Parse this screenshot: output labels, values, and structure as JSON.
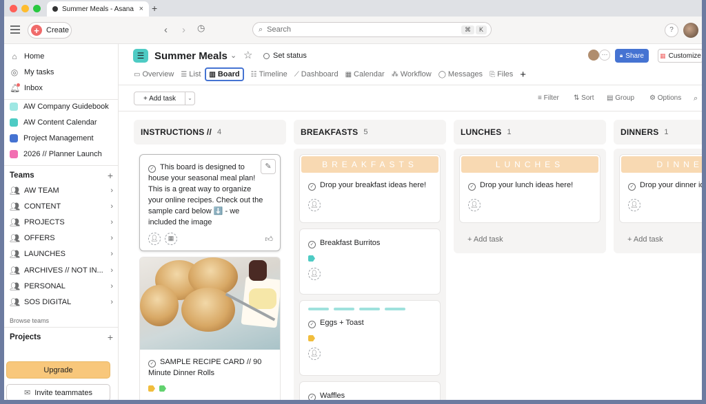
{
  "browser": {
    "tab_title": "Summer Meals - Asana",
    "close": "×",
    "new_tab": "+"
  },
  "topbar": {
    "create_label": "Create",
    "search_placeholder": "Search",
    "kbd": [
      "⌘",
      "K"
    ],
    "help": "?"
  },
  "sidebar": {
    "nav": [
      {
        "label": "Home",
        "icon": "home-icon"
      },
      {
        "label": "My tasks",
        "icon": "check-circle-icon"
      },
      {
        "label": "Inbox",
        "icon": "bell-icon"
      }
    ],
    "projects_pinned": [
      {
        "label": "AW Company Guidebook",
        "color": "#9ee7e3"
      },
      {
        "label": "AW Content Calendar",
        "color": "#4ecbc4"
      },
      {
        "label": "Project Management",
        "color": "#4573d2"
      },
      {
        "label": "2026 // Planner Launch",
        "color": "#f26fb2"
      }
    ],
    "teams_header": "Teams",
    "teams": [
      "AW TEAM",
      "CONTENT",
      "PROJECTS",
      "OFFERS",
      "LAUNCHES",
      "ARCHIVES // NOT IN...",
      "PERSONAL",
      "SOS DIGITAL"
    ],
    "browse_teams": "Browse teams",
    "projects_header": "Projects",
    "upgrade": "Upgrade",
    "invite": "Invite teammates"
  },
  "project": {
    "title": "Summer Meals",
    "set_status": "Set status",
    "share": "Share",
    "customize": "Customize",
    "tabs": [
      {
        "label": "Overview",
        "icon": "overview-icon"
      },
      {
        "label": "List",
        "icon": "list-icon"
      },
      {
        "label": "Board",
        "icon": "board-icon",
        "active": true
      },
      {
        "label": "Timeline",
        "icon": "timeline-icon"
      },
      {
        "label": "Dashboard",
        "icon": "dashboard-icon"
      },
      {
        "label": "Calendar",
        "icon": "calendar-icon"
      },
      {
        "label": "Workflow",
        "icon": "workflow-icon"
      },
      {
        "label": "Messages",
        "icon": "messages-icon"
      },
      {
        "label": "Files",
        "icon": "files-icon"
      }
    ],
    "add_tab": "+"
  },
  "toolbar": {
    "add_task": "+ Add task",
    "filter": "Filter",
    "sort": "Sort",
    "group": "Group",
    "options": "Options"
  },
  "columns": [
    {
      "name": "INSTRUCTIONS //",
      "count": "4",
      "cards": [
        {
          "title": "This board is designed to house your seasonal meal plan! This is a great way to organize your online recipes. Check out the sample card below ⬇️ - we included the image"
        },
        {
          "title": "SAMPLE RECIPE CARD // 90 Minute Dinner Rolls"
        }
      ]
    },
    {
      "name": "BREAKFASTS",
      "count": "5",
      "banner": "BREAKFASTS",
      "cards": [
        {
          "title": "Drop your breakfast ideas here!"
        },
        {
          "title": "Breakfast Burritos"
        },
        {
          "title": "Eggs + Toast"
        },
        {
          "title": "Waffles"
        }
      ]
    },
    {
      "name": "LUNCHES",
      "count": "1",
      "banner": "LUNCHES",
      "cards": [
        {
          "title": "Drop your lunch ideas here!"
        }
      ],
      "add_task": "+ Add task"
    },
    {
      "name": "DINNERS",
      "count": "1",
      "banner": "DINNERS",
      "cards": [
        {
          "title": "Drop your dinner ideas here!"
        }
      ],
      "add_task": "+ Add task"
    }
  ],
  "colors": {
    "accent": "#4573d2",
    "upgrade": "#f8c77b",
    "create": "#f06a6a",
    "banner": "#f8d9b2",
    "bar": "#9fe1dd"
  }
}
